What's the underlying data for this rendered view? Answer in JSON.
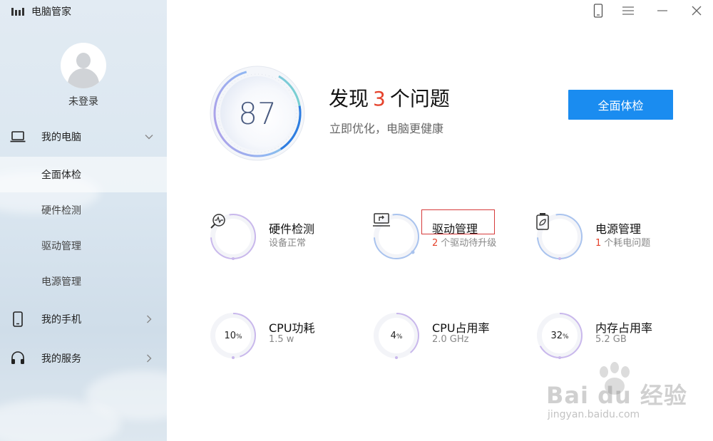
{
  "app": {
    "title": "电脑管家",
    "login_label": "未登录"
  },
  "sidebar": {
    "groups": [
      {
        "label": "我的电脑",
        "icon": "laptop-icon",
        "expanded": true
      },
      {
        "label": "我的手机",
        "icon": "phone-icon",
        "expanded": false
      },
      {
        "label": "我的服务",
        "icon": "headset-icon",
        "expanded": false
      }
    ],
    "sub_items": [
      {
        "label": "全面体检",
        "active": true
      },
      {
        "label": "硬件检测",
        "active": false
      },
      {
        "label": "驱动管理",
        "active": false
      },
      {
        "label": "电源管理",
        "active": false
      }
    ]
  },
  "window_controls": [
    "phone-icon",
    "menu-icon",
    "minimize-icon",
    "close-icon"
  ],
  "summary": {
    "score": "87",
    "headline_prefix": "发现",
    "headline_count": "3",
    "headline_suffix": "个问题",
    "subline": "立即优化，电脑更健康",
    "scan_button": "全面体检"
  },
  "cards": [
    {
      "title": "硬件检测",
      "sub_num": "",
      "sub_text": "设备正常",
      "icon": "hardware-scan-icon"
    },
    {
      "title": "驱动管理",
      "sub_num": "2",
      "sub_text": "个驱动待升级",
      "icon": "driver-icon"
    },
    {
      "title": "电源管理",
      "sub_num": "1",
      "sub_text": "个耗电问题",
      "icon": "battery-icon"
    },
    {
      "title": "CPU功耗",
      "value": "10",
      "unit": "%",
      "sub_text": "1.5 w",
      "level": 0.1
    },
    {
      "title": "CPU占用率",
      "value": "4",
      "unit": "%",
      "sub_text": "2.0 GHz",
      "level": 0.04
    },
    {
      "title": "内存占用率",
      "value": "32",
      "unit": "%",
      "sub_text": "5.2 GB",
      "level": 0.32
    }
  ],
  "watermark": {
    "text": "Bai du 经验",
    "url": "jingyan.baidu.com"
  },
  "colors": {
    "accent": "#1a8cf0",
    "alert": "#e5422b",
    "highlight": "#d63b3b"
  }
}
